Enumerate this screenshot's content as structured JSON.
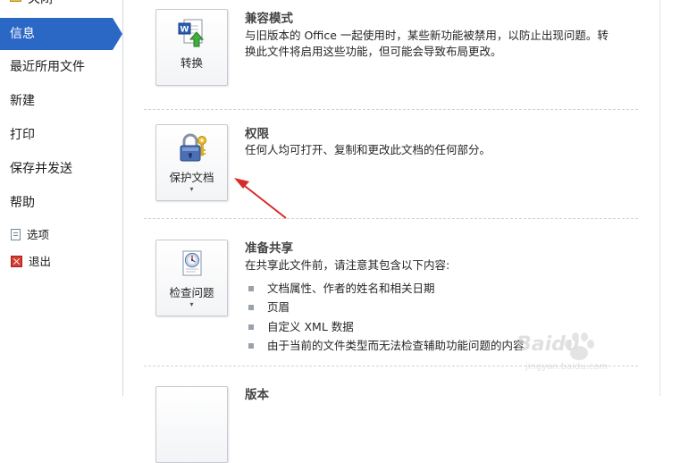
{
  "sidebar": {
    "items": [
      {
        "label": "关闭",
        "icon": "folder-icon",
        "active": false
      },
      {
        "label": "信息",
        "active": true
      },
      {
        "label": "最近所用文件",
        "active": false
      },
      {
        "label": "新建",
        "active": false
      },
      {
        "label": "打印",
        "active": false
      },
      {
        "label": "保存并发送",
        "active": false
      },
      {
        "label": "帮助",
        "active": false
      },
      {
        "label": "选项",
        "icon": "options-icon",
        "active": false
      },
      {
        "label": "退出",
        "icon": "exit-icon",
        "active": false
      }
    ]
  },
  "sections": {
    "compat": {
      "button_label": "转换",
      "icon": "word-convert-icon",
      "title": "兼容模式",
      "desc_line1": "与旧版本的 Office 一起使用时，某些新功能被禁用，以防止出现问题。转",
      "desc_line2": "换此文件将启用这些功能，但可能会导致布局更改。"
    },
    "permissions": {
      "button_label": "保护文档",
      "icon": "lock-key-icon",
      "caret": "▾",
      "title": "权限",
      "desc": "任何人均可打开、复制和更改此文档的任何部分。"
    },
    "prepare": {
      "button_label": "检查问题",
      "icon": "inspect-document-icon",
      "caret": "▾",
      "title": "准备共享",
      "desc": "在共享此文件前，请注意其包含以下内容:",
      "bullets": [
        "文档属性、作者的姓名和相关日期",
        "页眉",
        "自定义 XML 数据",
        "由于当前的文件类型而无法检查辅助功能问题的内容"
      ]
    },
    "versions": {
      "title": "版本"
    }
  },
  "colors": {
    "active_nav": "#2b67c5",
    "annotation_arrow": "#d92a2a"
  },
  "watermark": {
    "brand": "Baidu",
    "sub": "jingyan.baidu.com"
  }
}
